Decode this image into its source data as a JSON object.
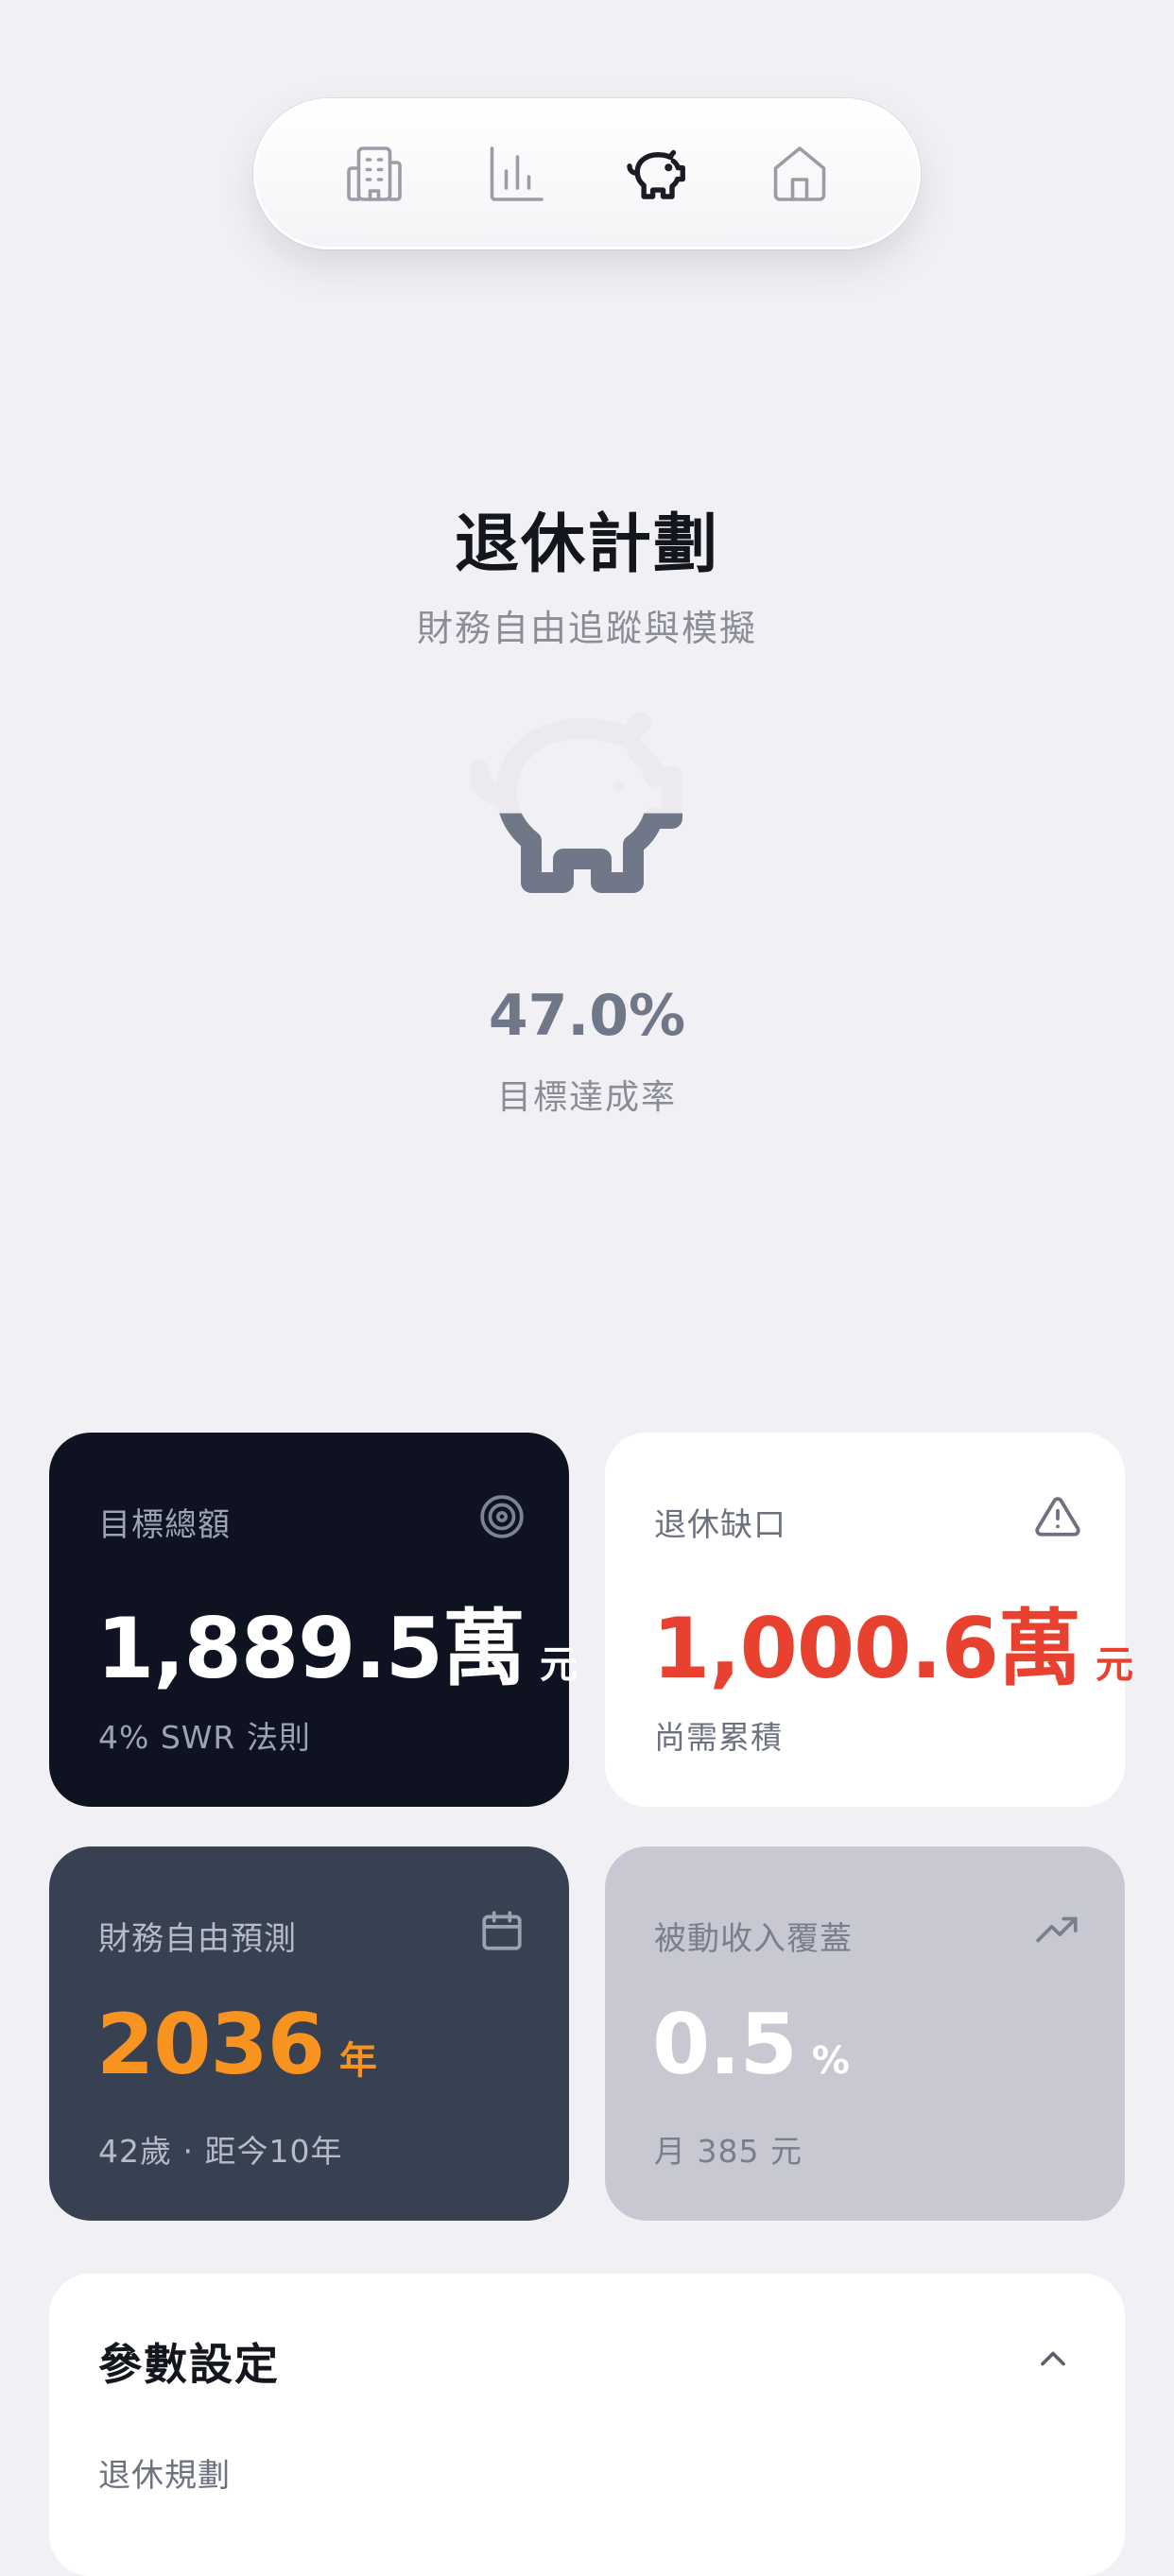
{
  "tabs": [
    {
      "icon": "building-icon",
      "active": false
    },
    {
      "icon": "bar-chart-icon",
      "active": false
    },
    {
      "icon": "piggy-bank-icon",
      "active": true
    },
    {
      "icon": "home-icon",
      "active": false
    }
  ],
  "header": {
    "title": "退休計劃",
    "subtitle": "財務自由追蹤與模擬"
  },
  "progress": {
    "percent": 47.0,
    "value_text": "47.0%",
    "label": "目標達成率",
    "fill_color": "#6f7788"
  },
  "cards": {
    "target": {
      "label": "目標總額",
      "value": "1,889.5萬",
      "unit": "元",
      "note": "4% SWR 法則",
      "icon": "target-icon"
    },
    "gap": {
      "label": "退休缺口",
      "value": "1,000.6萬",
      "unit": "元",
      "note": "尚需累積",
      "icon": "warning-icon",
      "value_color": "#e8412f"
    },
    "forecast": {
      "label": "財務自由預測",
      "value": "2036",
      "unit": "年",
      "note": "42歲 · 距今10年",
      "icon": "calendar-icon",
      "value_color": "#f7931e"
    },
    "passive": {
      "label": "被動收入覆蓋",
      "value": "0.5",
      "unit": "%",
      "note": "月 385 元",
      "icon": "trending-up-icon"
    }
  },
  "settings": {
    "title": "參數設定",
    "section_label": "退休規劃",
    "toggle_icon": "chevron-up-icon"
  }
}
